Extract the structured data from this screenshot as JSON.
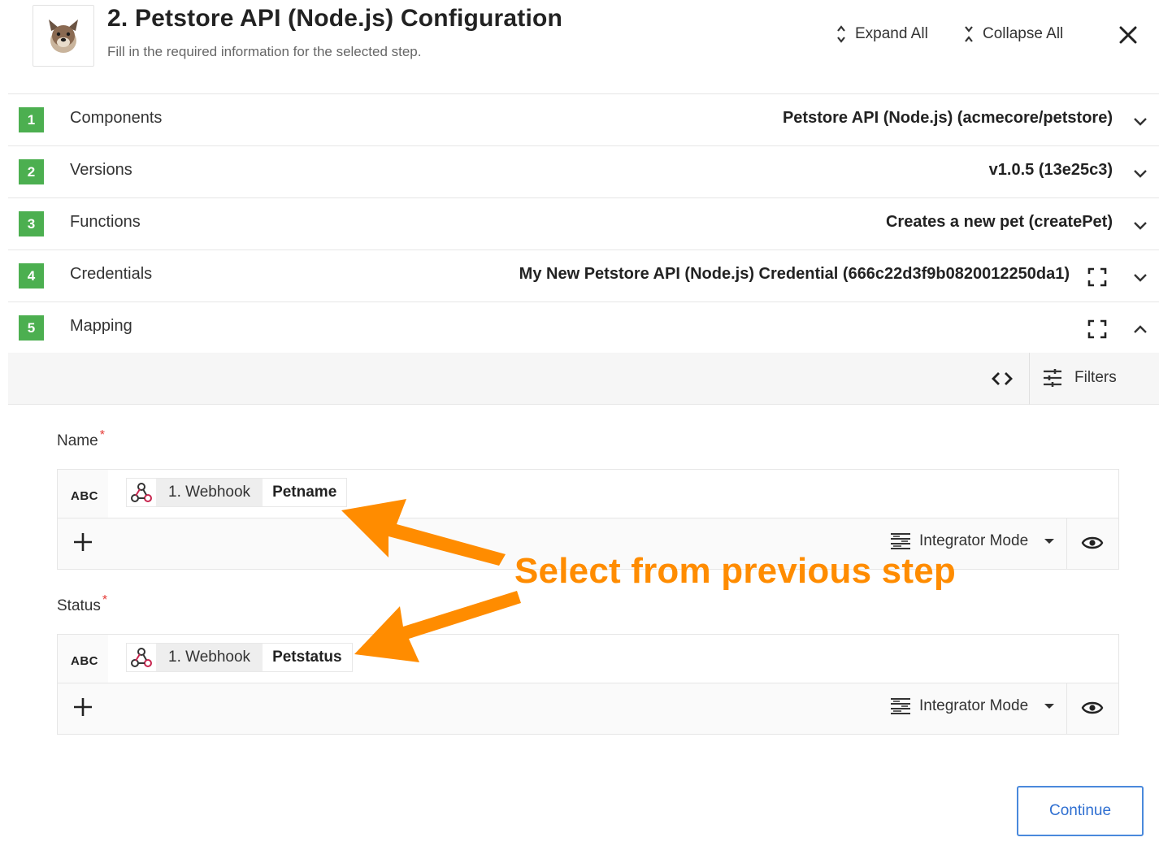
{
  "header": {
    "title": "2. Petstore API (Node.js) Configuration",
    "subtitle": "Fill in the required information for the selected step.",
    "expand_all": "Expand All",
    "collapse_all": "Collapse All"
  },
  "steps": [
    {
      "number": "1",
      "label": "Components",
      "value": "Petstore API (Node.js) (acmecore/petstore)",
      "expanded": false
    },
    {
      "number": "2",
      "label": "Versions",
      "value": "v1.0.5 (13e25c3)",
      "expanded": false
    },
    {
      "number": "3",
      "label": "Functions",
      "value": "Creates a new pet (createPet)",
      "expanded": false
    },
    {
      "number": "4",
      "label": "Credentials",
      "value": "My New Petstore API (Node.js) Credential (666c22d3f9b0820012250da1)",
      "expanded": false
    },
    {
      "number": "5",
      "label": "Mapping",
      "value": "",
      "expanded": true
    }
  ],
  "mapping": {
    "filters_label": "Filters",
    "fields": [
      {
        "label": "Name",
        "required_mark": "*",
        "type": "ABC",
        "chip_step": "1. Webhook",
        "chip_field": "Petname",
        "mode": "Integrator Mode"
      },
      {
        "label": "Status",
        "required_mark": "*",
        "type": "ABC",
        "chip_step": "1. Webhook",
        "chip_field": "Petstatus",
        "mode": "Integrator Mode"
      }
    ]
  },
  "continue_label": "Continue",
  "annotation": "Select from previous step",
  "colors": {
    "step_badge": "#4caf50",
    "annotation": "#ff8c00",
    "continue_border": "#4a89dc",
    "required": "#e53935"
  }
}
